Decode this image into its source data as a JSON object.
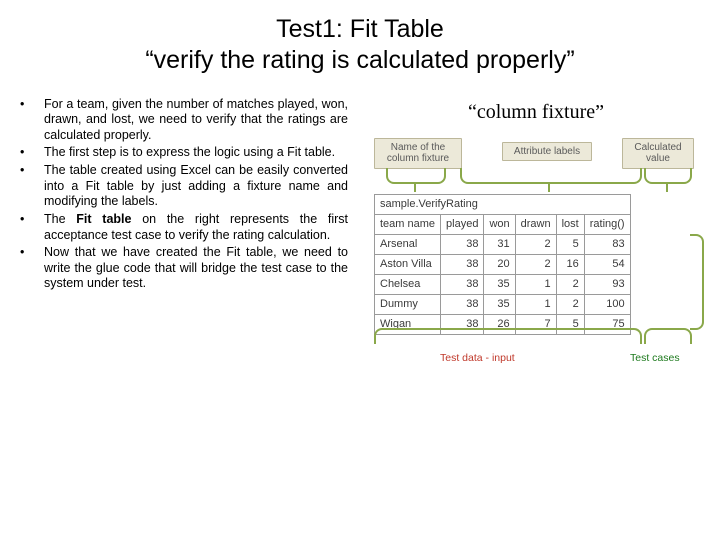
{
  "title_line1": "Test1: Fit Table",
  "title_line2": "“verify the rating is calculated properly”",
  "bullets": [
    "For a team, given the number of matches played, won, drawn, and lost, we need to verify that the ratings are calculated properly.",
    "The first step is to express the logic using a Fit table.",
    "The table created using Excel can be easily converted into a Fit table by just adding a fixture name and modifying the labels.",
    "The Fit table on the right represents the first acceptance test case to verify the rating calculation.",
    "Now that we have created the Fit table, we need to write the glue code that will bridge the test case to the system under test."
  ],
  "bullet3_bold": "Fit table",
  "column_fixture_caption": "“column fixture”",
  "callouts": {
    "c1": "Name of the column fixture",
    "c2": "Attribute labels",
    "c3": "Calculated value"
  },
  "labels": {
    "bottom_left": "Test data - input",
    "bottom_right": "Test cases"
  },
  "fit_table": {
    "fixture_name": "sample.VerifyRating",
    "headers": [
      "team name",
      "played",
      "won",
      "drawn",
      "lost",
      "rating()"
    ],
    "rows": [
      [
        "Arsenal",
        "38",
        "31",
        "2",
        "5",
        "83"
      ],
      [
        "Aston Villa",
        "38",
        "20",
        "2",
        "16",
        "54"
      ],
      [
        "Chelsea",
        "38",
        "35",
        "1",
        "2",
        "93"
      ],
      [
        "Dummy",
        "38",
        "35",
        "1",
        "2",
        "100"
      ],
      [
        "Wigan",
        "38",
        "26",
        "7",
        "5",
        "75"
      ]
    ]
  }
}
